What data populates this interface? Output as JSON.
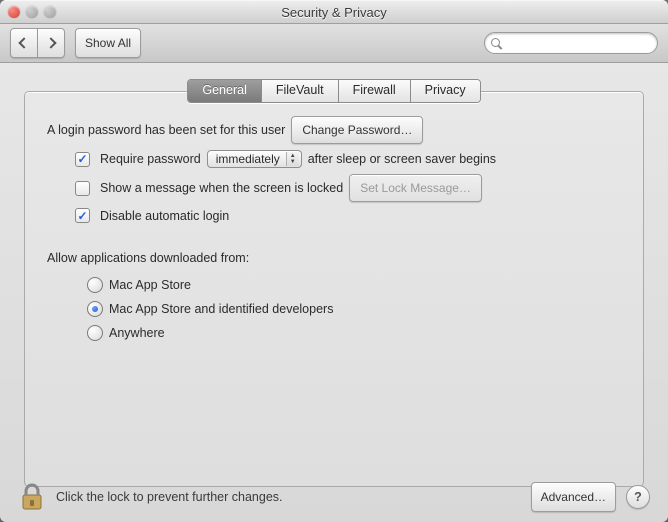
{
  "window": {
    "title": "Security & Privacy"
  },
  "toolbar": {
    "show_all_label": "Show All",
    "search_placeholder": ""
  },
  "tabs": [
    {
      "id": "general",
      "label": "General",
      "active": true
    },
    {
      "id": "filevault",
      "label": "FileVault",
      "active": false
    },
    {
      "id": "firewall",
      "label": "Firewall",
      "active": false
    },
    {
      "id": "privacy",
      "label": "Privacy",
      "active": false
    }
  ],
  "login_section": {
    "password_set_text": "A login password has been set for this user",
    "change_password_btn": "Change Password…",
    "require_pw_label": "Require password",
    "require_pw_delay_value": "immediately",
    "require_pw_suffix": "after sleep or screen saver begins",
    "show_message_label": "Show a message when the screen is locked",
    "set_lock_message_btn": "Set Lock Message…",
    "disable_auto_login_label": "Disable automatic login",
    "require_pw_checked": true,
    "show_message_checked": false,
    "disable_auto_login_checked": true
  },
  "gatekeeper": {
    "heading": "Allow applications downloaded from:",
    "options": [
      {
        "id": "mas",
        "label": "Mac App Store",
        "checked": false,
        "highlighted": false
      },
      {
        "id": "identified",
        "label": "Mac App Store and identified developers",
        "checked": true,
        "highlighted": false
      },
      {
        "id": "anywhere",
        "label": "Anywhere",
        "checked": false,
        "highlighted": true
      }
    ]
  },
  "footer": {
    "lock_text": "Click the lock to prevent further changes.",
    "advanced_btn": "Advanced…",
    "help_char": "?"
  }
}
